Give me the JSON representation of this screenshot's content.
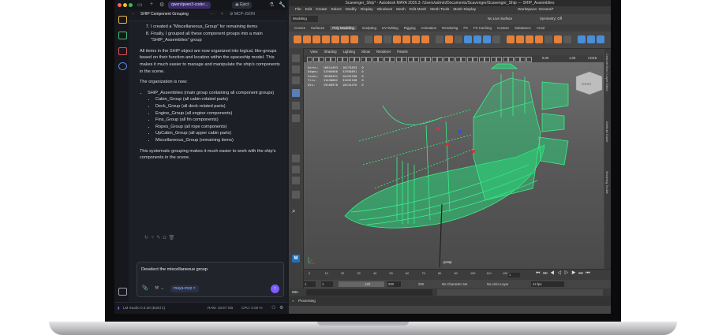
{
  "lmstudio": {
    "tab_title": "SHIP Component Grouping",
    "model_pill": "qwen/qwen3-coder...",
    "eject_label": "Eject",
    "chat": {
      "list_tail": [
        {
          "num": "7.",
          "text": "I created a \"Miscellaneous_Group\" for remaining items"
        },
        {
          "num": "8.",
          "text": "Finally, I grouped all these component groups into a main \"SHIP_Assemblies\" group"
        }
      ],
      "para1": "All items in the SHIP object are now organized into logical, like-groups based on their function and location within the spaceship model. This makes it much easier to manage and manipulate the ship's components in the scene.",
      "para2": "The organization is now:",
      "root_group": "SHIP_Assemblies (main group containing all component groups)",
      "sub_groups": [
        "Cabin_Group (all cabin-related parts)",
        "Deck_Group (all deck-related parts)",
        "Engine_Group (all engine components)",
        "Fins_Group (all fin components)",
        "Ropes_Group (all rope components)",
        "UpCabin_Group (all upper cabin parts)",
        "Miscellaneous_Group (remaining items)"
      ],
      "para3": "This systematic grouping makes it much easier to work with the ship's components in the scene."
    },
    "input_text": "Deselect the miscellaneous group",
    "mcp_chip": "maya-mcp",
    "status": {
      "app": "LM Studio 0.3.30 (Build 2)",
      "ram": "RAM: 18.87 GB",
      "cpu": "CPU: 0.00 %"
    }
  },
  "maya": {
    "title": "Scavenger_Ship* - Autodesk MAYA 2026.3: /Users/admin/Documents/Scavenger/Scavenger_Ship   ---   SHIP_Assemblies",
    "menus": [
      "File",
      "Edit",
      "Create",
      "Select",
      "Modify",
      "Display",
      "Windows",
      "Mesh",
      "Edit Mesh",
      "Mesh Tools",
      "Mesh Display"
    ],
    "workspace": "Workspace: General*",
    "mode": "Modeling",
    "no_live_surface": "No Live Surface",
    "symmetry": "Symmetry: Off",
    "shelf_tabs": [
      "Curves",
      "Surfaces",
      "Poly Modeling",
      "Sculpting",
      "UV Editing",
      "Rigging",
      "Animation",
      "Rendering",
      "FX",
      "FX Caching",
      "Custom",
      "Substance",
      "Arnol"
    ],
    "active_shelf": "Poly Modeling",
    "viewport_menu": [
      "View",
      "Shading",
      "Lighting",
      "Show",
      "Renderer",
      "Panels"
    ],
    "hud": [
      {
        "label": "Verts:",
        "a": "16814493",
        "b": "16175833",
        "c": "0"
      },
      {
        "label": "Edges:",
        "a": "31905060",
        "b": "32938891",
        "c": "0"
      },
      {
        "label": "Faces:",
        "a": "16966491",
        "b": "16432938",
        "c": "0"
      },
      {
        "label": "Tris:",
        "a": "31030882",
        "b": "32635108",
        "c": "0"
      },
      {
        "label": "UVs:",
        "a": "19168970",
        "b": "18134476",
        "c": "0"
      }
    ],
    "camera_label": "persp",
    "view_cube": "FRONT",
    "vp_values": {
      "a": "0.00",
      "b": "1.00",
      "aces": "ACES"
    },
    "right_panels": [
      "Channel Box / Layer Editor",
      "Attribute Editor",
      "Modeling Toolkit"
    ],
    "timeline_ticks": [
      "0",
      "10",
      "20",
      "30",
      "40",
      "50",
      "60",
      "70",
      "80",
      "90",
      "100",
      "110",
      "120"
    ],
    "current_frame": "1",
    "range": {
      "start": "1",
      "start2": "1",
      "end": "120",
      "end2": "200"
    },
    "no_character_set": "No Character Set",
    "no_anim_layer": "No Anim Layer",
    "fps": "24 fps",
    "mel": "MEL",
    "help": "Processing",
    "colors": {
      "wire": "#38f08a",
      "bg": "#5a5a5a"
    }
  }
}
